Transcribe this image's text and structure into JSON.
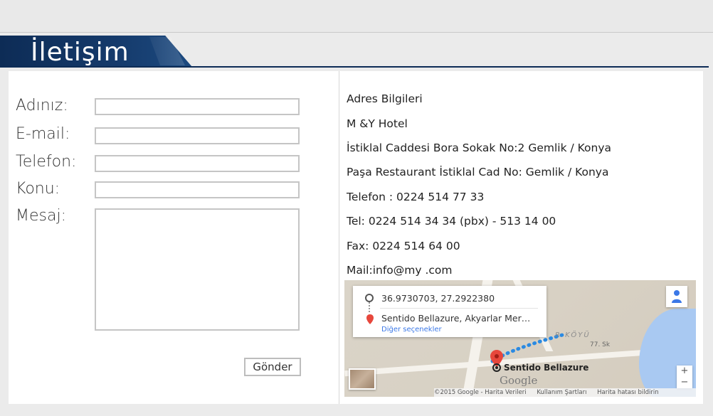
{
  "page": {
    "title": "İletişim"
  },
  "form": {
    "name_label": "Adınız:",
    "email_label": "E-mail:",
    "phone_label": "Telefon:",
    "subject_label": "Konu:",
    "message_label": "Mesaj:",
    "submit_label": "Gönder"
  },
  "address": {
    "heading": "Adres Bilgileri",
    "hotel": "M &Y Hotel",
    "line1": "İstiklal Caddesi Bora Sokak No:2 Gemlik / Konya",
    "line2": "Paşa Restaurant İstiklal Cad No: Gemlik / Konya",
    "phone": "Telefon : 0224 514 77 33",
    "tel": "Tel: 0224 514 34 34 (pbx) - 513 14 00",
    "fax": "Fax: 0224 514 64 00",
    "mail": "Mail:info@my .com"
  },
  "map": {
    "origin": "36.9730703, 27.2922380",
    "destination": "Sentido Bellazure, Akyarlar Mer…",
    "more_options": "Diğer seçenekler",
    "dest_label": "Sentido Bellazure",
    "area_label": "R KÖYÜ",
    "street_label": "77. Sk",
    "google": "Google",
    "footer_copyright": "©2015 Google - Harita Verileri",
    "footer_terms": "Kullanım Şartları",
    "footer_report": "Harita hatası bildirin",
    "zoom_in": "+",
    "zoom_out": "−",
    "colors": {
      "water": "#a9c9f2",
      "route": "#2b8ae2",
      "pin": "#e7473c"
    }
  },
  "colors": {
    "header_blue": "#0d2c56",
    "background": "#ebebeb"
  }
}
